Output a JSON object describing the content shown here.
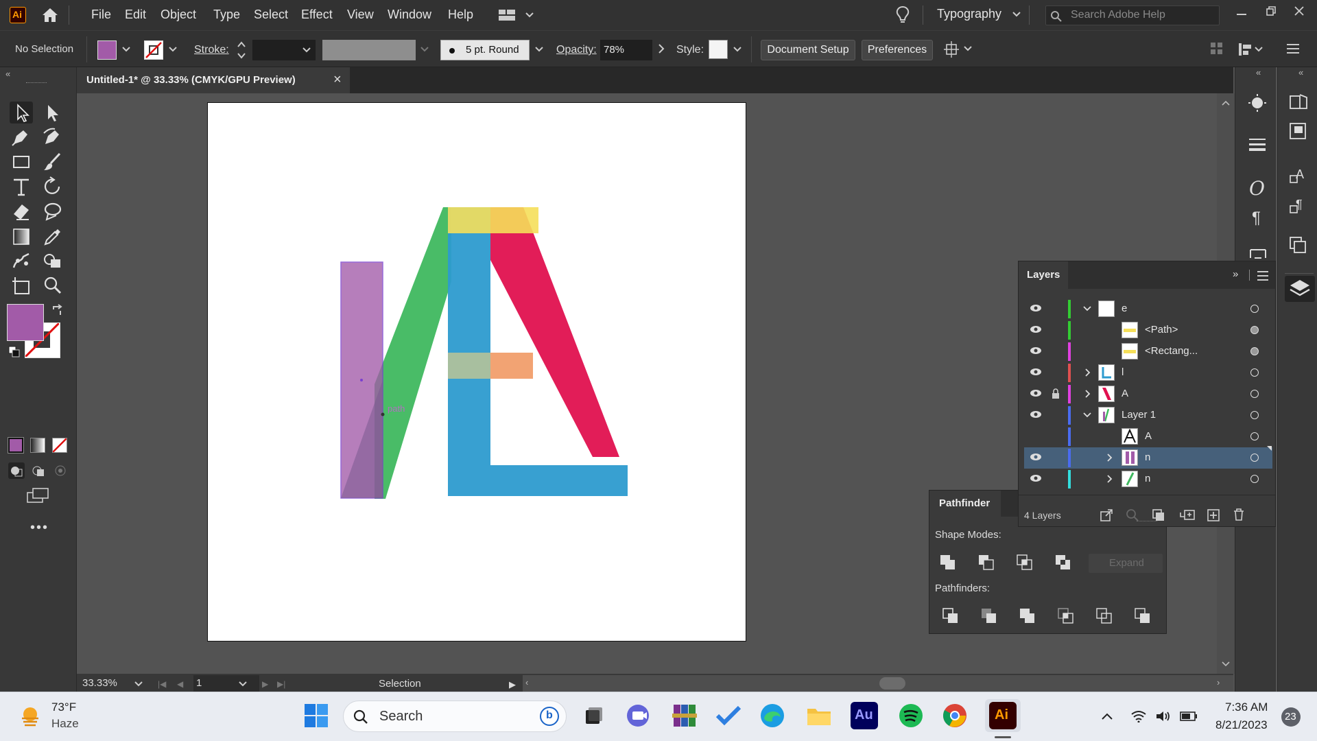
{
  "app": {
    "logo_text": "Ai",
    "menu": [
      "File",
      "Edit",
      "Object",
      "Type",
      "Select",
      "Effect",
      "View",
      "Window",
      "Help"
    ],
    "workspace": "Typography",
    "search_placeholder": "Search Adobe Help"
  },
  "control_bar": {
    "selection_status": "No Selection",
    "stroke_label": "Stroke:",
    "brush_label": "5 pt. Round",
    "opacity_label": "Opacity:",
    "opacity_value": "78%",
    "style_label": "Style:",
    "document_setup": "Document Setup",
    "preferences": "Preferences"
  },
  "document_tab": {
    "title": "Untitled-1* @ 33.33% (CMYK/GPU Preview)",
    "close": "×"
  },
  "artwork": {
    "hover_label": "path"
  },
  "status_bar": {
    "zoom": "33.33%",
    "artboard_number": "1",
    "tool_name": "Selection"
  },
  "layers_panel": {
    "title": "Layers",
    "rows": [
      {
        "name": "e",
        "color": "#33cc33",
        "expanded": true,
        "visible": true,
        "locked": false
      },
      {
        "name": "<Path>",
        "color": "#33cc33",
        "visible": true
      },
      {
        "name": "<Rectang...",
        "color": "#e040e0",
        "visible": true
      },
      {
        "name": "l",
        "color": "#e05050",
        "expanded": false,
        "visible": true
      },
      {
        "name": "A",
        "color": "#e040e0",
        "expanded": false,
        "visible": true,
        "locked": true
      },
      {
        "name": "Layer 1",
        "color": "#4a6cf0",
        "expanded": true,
        "visible": true
      },
      {
        "name": "A",
        "color": "#4a6cf0",
        "visible": false
      },
      {
        "name": "n",
        "color": "#4a6cf0",
        "expanded": false,
        "visible": true,
        "selected": true
      },
      {
        "name": "n",
        "color": "#33dddd",
        "expanded": false,
        "visible": true
      }
    ],
    "footer_count": "4 Layers"
  },
  "pathfinder_panel": {
    "title": "Pathfinder",
    "shape_modes_label": "Shape Modes:",
    "expand_label": "Expand",
    "pathfinders_label": "Pathfinders:"
  },
  "taskbar": {
    "weather_temp": "73°F",
    "weather_desc": "Haze",
    "search_label": "Search",
    "time": "7:36 AM",
    "date": "8/21/2023",
    "notification_count": "23"
  }
}
